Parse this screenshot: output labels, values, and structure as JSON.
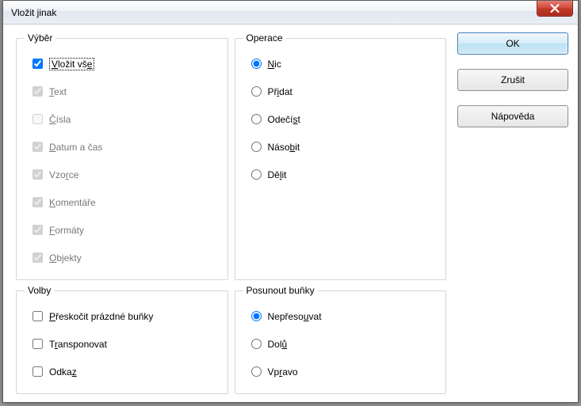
{
  "title": "Vložit jinak",
  "buttons": {
    "ok": "OK",
    "cancel": "Zrušit",
    "help": "Nápověda"
  },
  "groups": {
    "selection": {
      "legend": "Výběr",
      "items": {
        "paste_all": "Vložit vše",
        "text": "Text",
        "numbers": "Čísla",
        "datetime": "Datum a čas",
        "formulas": "Vzorce",
        "comments": "Komentáře",
        "formats": "Formáty",
        "objects": "Objekty"
      }
    },
    "operations": {
      "legend": "Operace",
      "items": {
        "none": "Nic",
        "add": "Přidat",
        "subtract": "Odečíst",
        "multiply": "Násobit",
        "divide": "Dělit"
      }
    },
    "options": {
      "legend": "Volby",
      "items": {
        "skip_empty": "Přeskočit prázdné buňky",
        "transpose": "Transponovat",
        "link": "Odkaz"
      }
    },
    "shift": {
      "legend": "Posunout buňky",
      "items": {
        "dont_move": "Nepřesouvat",
        "down": "Dolů",
        "right": "Vpravo"
      }
    }
  }
}
